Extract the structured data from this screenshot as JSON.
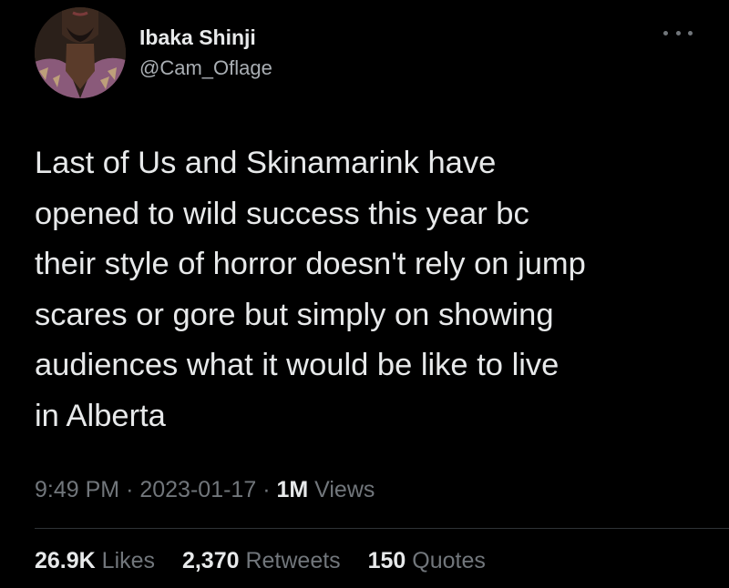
{
  "author": {
    "display_name": "Ibaka Shinji",
    "handle": "@Cam_Oflage"
  },
  "menu_icon": "more-horizontal-icon",
  "tweet": {
    "text": "Last of Us and Skinamarink have\nopened to wild success this year bc\ntheir style of horror doesn't rely on jump\nscares or gore but simply on showing\naudiences what it would be like to live\nin Alberta"
  },
  "meta": {
    "time": "9:49 PM",
    "separator": "·",
    "date": "2023-01-17",
    "views_count": "1M",
    "views_label": "Views"
  },
  "stats": {
    "likes_count": "26.9K",
    "likes_label": "Likes",
    "retweets_count": "2,370",
    "retweets_label": "Retweets",
    "quotes_count": "150",
    "quotes_label": "Quotes"
  },
  "colors": {
    "background": "#000000",
    "primary_text": "#e7e9ea",
    "secondary_text": "#71767b",
    "divider": "#2f3336"
  }
}
